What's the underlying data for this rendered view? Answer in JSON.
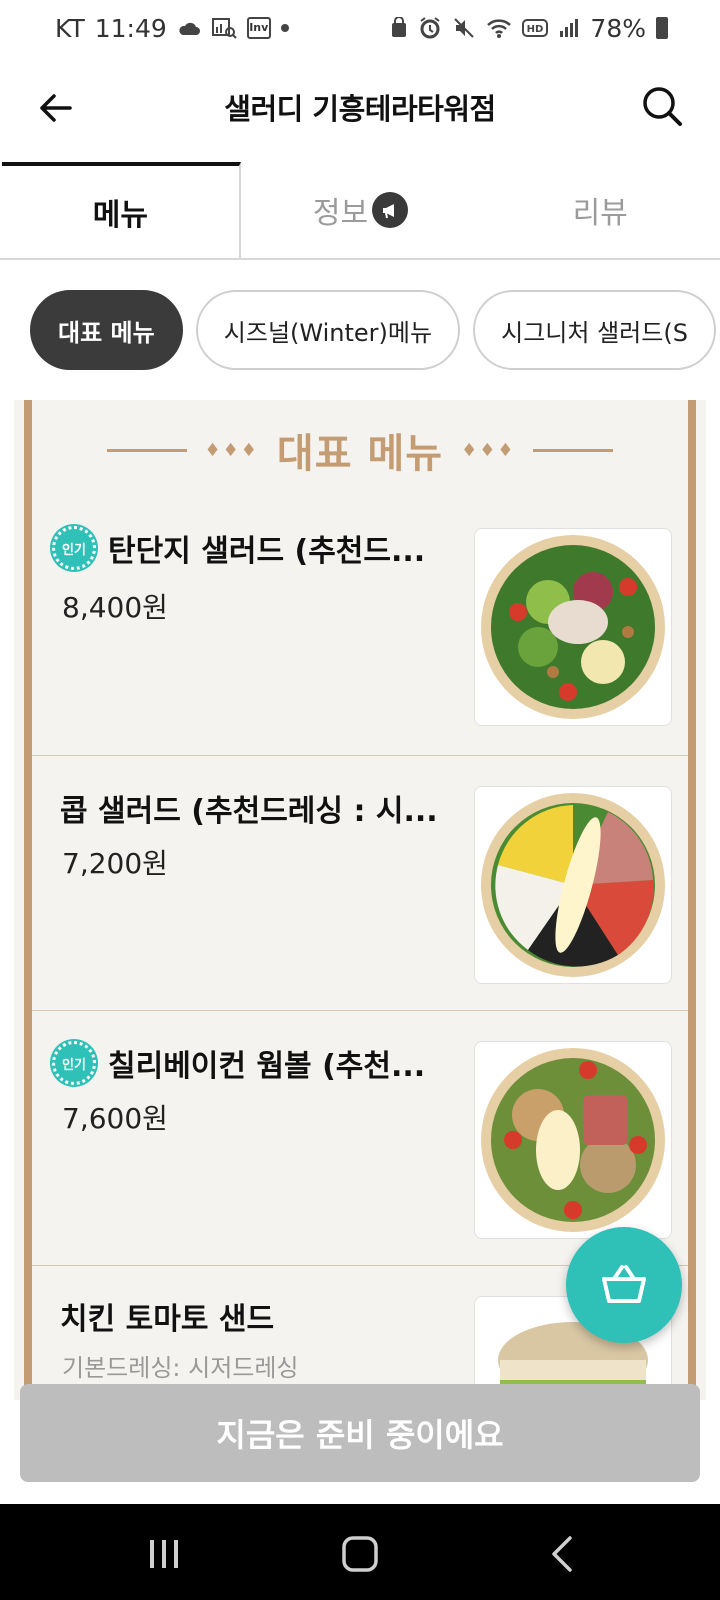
{
  "status_bar": {
    "carrier": "KT",
    "time": "11:49",
    "battery": "78%",
    "left_icons": [
      "cloud-icon",
      "gallery-icon",
      "inv-app-icon",
      "dot-icon"
    ],
    "right_icons": [
      "vpn-icon",
      "alarm-icon",
      "mute-icon",
      "wifi-icon",
      "hd-icon",
      "signal-icon",
      "battery-icon"
    ],
    "inv_label": "Inv"
  },
  "header": {
    "title": "샐러디 기흥테라타워점"
  },
  "tabs": [
    {
      "label": "메뉴",
      "active": true
    },
    {
      "label": "정보",
      "active": false
    },
    {
      "label": "리뷰",
      "active": false
    }
  ],
  "categories": [
    {
      "label": "대표 메뉴",
      "active": true
    },
    {
      "label": "시즈널(Winter)메뉴",
      "active": false
    },
    {
      "label": "시그니처 샐러드(S",
      "active": false
    }
  ],
  "section": {
    "title": "대표 메뉴",
    "diamonds": "♦♦♦"
  },
  "menu_items": [
    {
      "badge": "인기",
      "name": "탄단지 샐러드 (추천드...",
      "price": "8,400원",
      "thumb": "salad-bowl-image"
    },
    {
      "badge": "",
      "name": "콥 샐러드 (추천드레싱 : 시...",
      "price": "7,200원",
      "thumb": "cobb-salad-image"
    },
    {
      "badge": "인기",
      "name": "칠리베이컨 웜볼 (추천...",
      "price": "7,600원",
      "thumb": "warm-bowl-image"
    },
    {
      "badge": "",
      "name": "치킨 토마토 샌드",
      "sub": "기본드레싱: 시저드레싱",
      "thumb": "sandwich-image"
    }
  ],
  "cta": {
    "label": "지금은 준비 중이에요"
  },
  "colors": {
    "accent": "#2fc0b8",
    "board_gold": "#c49c73",
    "chip_active": "#3b3b3b",
    "cta_disabled": "#bdbdbd"
  }
}
